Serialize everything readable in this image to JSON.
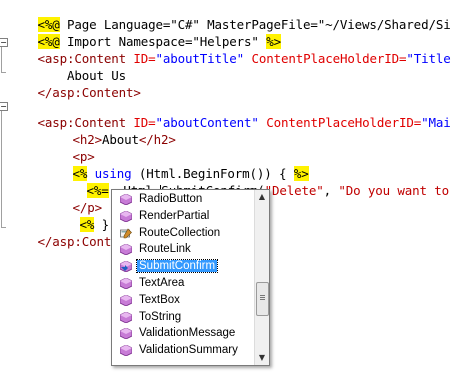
{
  "code": {
    "l1_a": "<%@",
    "l1_b": " Page Language=\"C#\" MasterPageFile=\"~/Views/Shared/Si",
    "l2_a": "<%@",
    "l2_b": " Import Namespace=\"Helpers\" ",
    "l2_c": "%>",
    "l3_tag": "<asp:Content",
    "l3_id_attr": " ID=",
    "l3_id_val": "\"aboutTitle\"",
    "l3_cph_attr": " ContentPlaceHolderID=",
    "l3_cph_val": "\"Title",
    "l4_text": "    About Us",
    "l5_tag": "</asp:Content>",
    "l7_tag": "<asp:Content",
    "l7_id_attr": " ID=",
    "l7_id_val": "\"aboutContent\"",
    "l7_cph_attr": " ContentPlaceHolderID=",
    "l7_cph_val": "\"Mai",
    "l8_open": "<h2>",
    "l8_text": "About",
    "l8_close": "</h2>",
    "l9_tag": "<p>",
    "l10_open": "<%",
    "l10_kw": " using",
    "l10_text": " (Html.BeginForm()) { ",
    "l10_close": "%>",
    "l11_open": "<%=",
    "l11_text1": "  Html.",
    "l11_text2": "ubmitConfirm(",
    "l11_str1": "\"Delete\"",
    "l11_comma": ", ",
    "l11_str2": "\"Do you want to",
    "l11_caret_char": "S",
    "l12_tag": "</p>",
    "l13_open": "<%",
    "l13_text": " } ",
    "l13_close": "%>",
    "l14_tag": "</asp:Content"
  },
  "intellisense": {
    "items": [
      {
        "label": "RadioButton",
        "icon": "method-icon"
      },
      {
        "label": "RenderPartial",
        "icon": "method-icon"
      },
      {
        "label": "RouteCollection",
        "icon": "property-icon"
      },
      {
        "label": "RouteLink",
        "icon": "method-icon"
      },
      {
        "label": "SubmitConfirm",
        "icon": "extension-method-icon",
        "selected": true
      },
      {
        "label": "TextArea",
        "icon": "method-icon"
      },
      {
        "label": "TextBox",
        "icon": "method-icon"
      },
      {
        "label": "ToString",
        "icon": "method-icon"
      },
      {
        "label": "ValidationMessage",
        "icon": "method-icon"
      },
      {
        "label": "ValidationSummary",
        "icon": "method-icon"
      }
    ],
    "scroll_up_glyph": "▲",
    "scroll_down_glyph": "▼"
  },
  "colors": {
    "tag": "#8b0000",
    "attribute": "#e00000",
    "string": "#0000ff",
    "delimiter_bg": "#fff200",
    "selection": "#3399ff"
  }
}
